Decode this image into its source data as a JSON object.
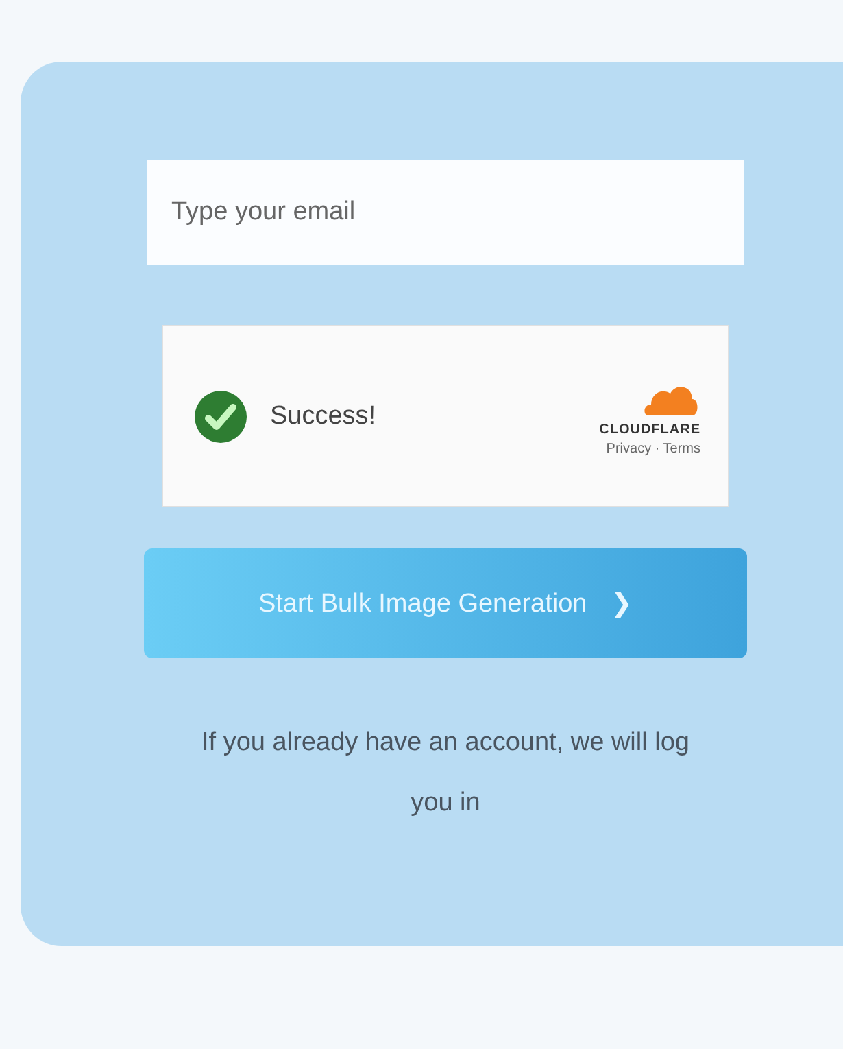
{
  "email_field": {
    "placeholder": "Type your email"
  },
  "captcha": {
    "verified": true,
    "status": "Success!",
    "brand": "CLOUDFLARE",
    "links": "Privacy · Terms"
  },
  "submit_button": {
    "label": "Start Bulk Image Generation",
    "icon": "❯"
  },
  "note": "If you already have an account, we will log you in"
}
